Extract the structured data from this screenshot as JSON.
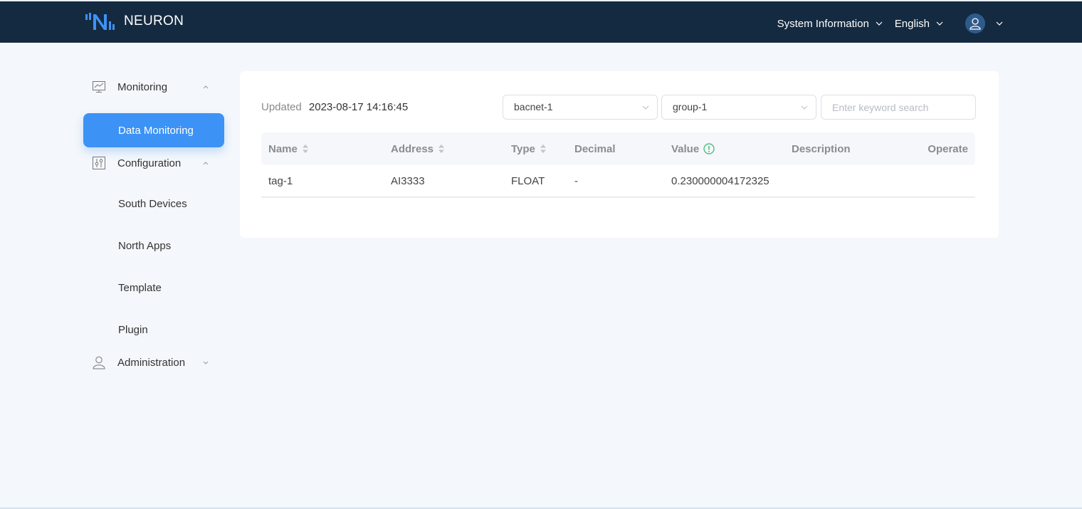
{
  "header": {
    "brand": "NEURON",
    "system_info_label": "System Information",
    "language_label": "English",
    "colors": {
      "bar": "#142a40",
      "logo_accent": "#3d92f5"
    }
  },
  "sidebar": {
    "groups": [
      {
        "label": "Monitoring",
        "icon": "monitor-chart-icon",
        "expanded": true,
        "items": [
          {
            "label": "Data Monitoring",
            "active": true
          }
        ]
      },
      {
        "label": "Configuration",
        "icon": "sliders-icon",
        "expanded": true,
        "items": [
          {
            "label": "South Devices"
          },
          {
            "label": "North Apps"
          },
          {
            "label": "Template"
          },
          {
            "label": "Plugin"
          }
        ]
      },
      {
        "label": "Administration",
        "icon": "user-icon",
        "expanded": false,
        "items": []
      }
    ],
    "active_color": "#3d92f5"
  },
  "main": {
    "updated_label": "Updated",
    "updated_value": "2023-08-17 14:16:45",
    "node_select": "bacnet-1",
    "group_select": "group-1",
    "search": {
      "placeholder": "Enter keyword search",
      "value": ""
    },
    "table": {
      "columns": [
        "Name",
        "Address",
        "Type",
        "Decimal",
        "Value",
        "Description",
        "Operate"
      ],
      "rows": [
        {
          "name": "tag-1",
          "address": "AI3333",
          "type": "FLOAT",
          "decimal": "-",
          "value": "0.230000004172325",
          "description": "",
          "operate": ""
        }
      ]
    }
  }
}
